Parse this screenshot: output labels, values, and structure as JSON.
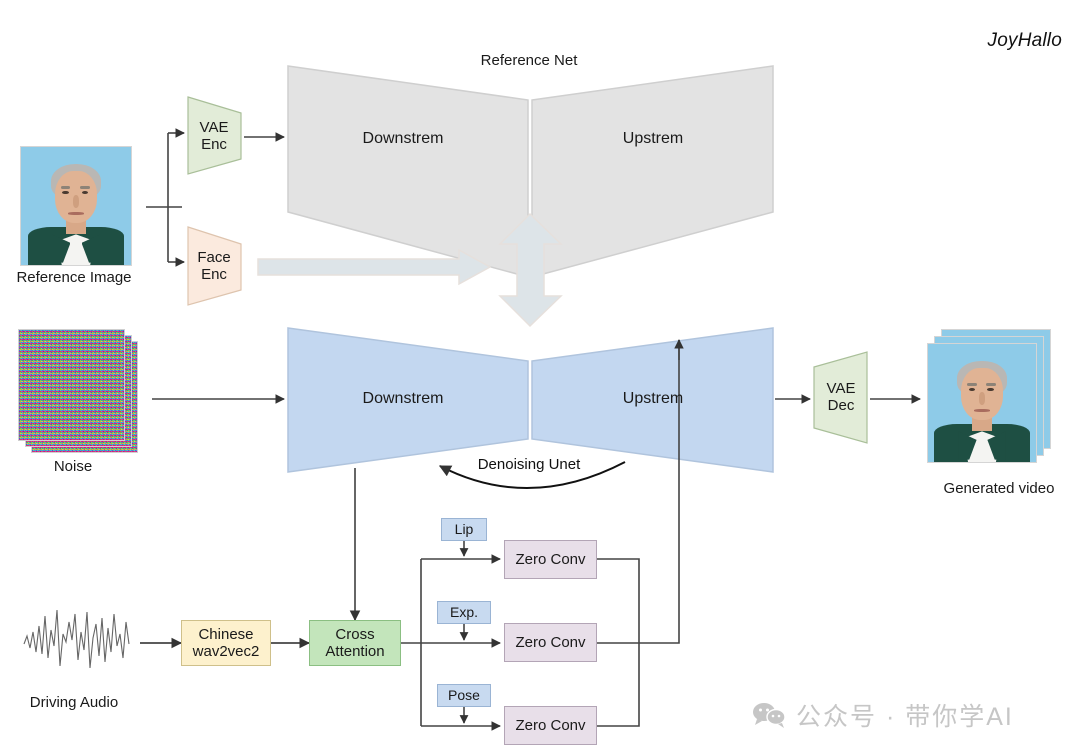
{
  "paper": {
    "title": "JoyHallo"
  },
  "sections": {
    "reference_net_title": "Reference Net",
    "denoising_unet_label": "Denoising Unet"
  },
  "inputs": {
    "reference_image_label": "Reference Image",
    "noise_label": "Noise",
    "driving_audio_label": "Driving Audio"
  },
  "outputs": {
    "generated_video_label": "Generated video"
  },
  "encoders": {
    "vae_enc": "VAE\nEnc",
    "face_enc": "Face\nEnc",
    "vae_dec": "VAE\nDec"
  },
  "reference_net": {
    "downstream": "Downstrem",
    "upstream": "Upstrem"
  },
  "denoising_unet": {
    "downstream": "Downstrem",
    "upstream": "Upstrem"
  },
  "audio_branch": {
    "wav2vec": "Chinese\nwav2vec2",
    "cross_attention": "Cross\nAttention"
  },
  "control_cues": [
    {
      "label": "Lip",
      "conv": "Zero Conv"
    },
    {
      "label": "Exp.",
      "conv": "Zero Conv"
    },
    {
      "label": "Pose",
      "conv": "Zero Conv"
    }
  ],
  "watermark": {
    "text": "公众号 · 带你学AI"
  },
  "colors": {
    "reference_net_fill": "#e3e3e3",
    "denoising_unet_fill": "#c3d7f0",
    "vae_fill": "#e2ecd8",
    "face_enc_fill": "#fbeade",
    "wav2vec_fill": "#fdf1cd",
    "cross_attention_fill": "#c3e5bb",
    "zero_conv_fill": "#e8dfe9",
    "cue_fill": "#c8daf0",
    "block_arrow_fill": "#dde4e8",
    "line": "#444444"
  }
}
